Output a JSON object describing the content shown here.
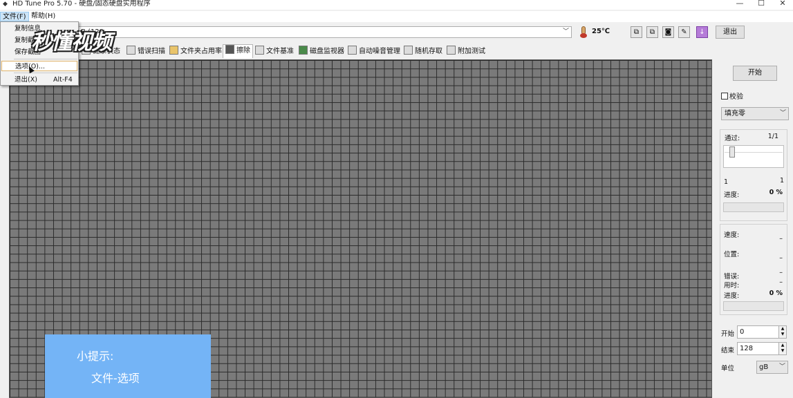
{
  "window": {
    "title": "HD Tune Pro 5.70 - 硬盘/固态硬盘实用程序",
    "minimize": "—",
    "maximize": "☐",
    "close": "✕"
  },
  "menubar": {
    "file": "文件(F)",
    "help": "帮助(H)"
  },
  "file_menu": {
    "items": [
      {
        "label": "复制信息"
      },
      {
        "label": "复制截图"
      },
      {
        "label": "保存截图"
      },
      {
        "label": "选项(O)..."
      },
      {
        "label": "退出(X)",
        "accel": "Alt-F4"
      }
    ]
  },
  "watermark": "秒懂视频",
  "toolbar": {
    "drive_value": "B (128",
    "temperature": "25℃",
    "exit_label": "退出"
  },
  "tabs": [
    {
      "label": "健康状态"
    },
    {
      "label": "错误扫描"
    },
    {
      "label": "文件夹占用率"
    },
    {
      "label": "擦除"
    },
    {
      "label": "文件基准"
    },
    {
      "label": "磁盘监视器"
    },
    {
      "label": "自动噪音管理"
    },
    {
      "label": "随机存取"
    },
    {
      "label": "附加测试"
    }
  ],
  "right_panel": {
    "start_label": "开始",
    "verify_label": "校验",
    "fill_value": "填充零",
    "pass_label": "通过:",
    "pass_value": "1/1",
    "slider_min": "1",
    "slider_max": "1",
    "progress_label": "进度:",
    "progress_value": "0 %",
    "speed_label": "速度:",
    "speed_value": "–",
    "position_label": "位置:",
    "position_value": "–",
    "error_label": "错误:",
    "error_value": "–",
    "time_label": "用时:",
    "time_value": "–",
    "progress2_label": "进度:",
    "progress2_value": "0 %",
    "start_field_label": "开始",
    "start_field_value": "0",
    "end_field_label": "结束",
    "end_field_value": "128",
    "unit_label": "单位",
    "unit_value": "gB"
  },
  "hint": {
    "line1": "小提示:",
    "line2": "文件-选项"
  }
}
